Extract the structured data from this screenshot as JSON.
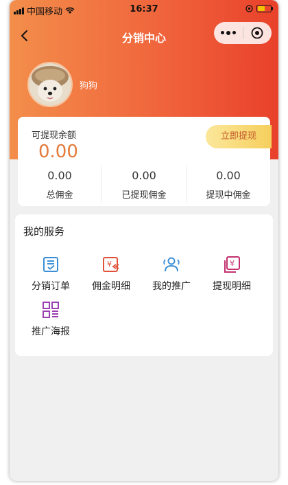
{
  "status_bar": {
    "carrier": "中国移动",
    "time": "16:37"
  },
  "nav": {
    "title": "分销中心"
  },
  "profile": {
    "username": "狗狗"
  },
  "balance": {
    "label": "可提现余额",
    "amount": "0.00",
    "withdraw_button": "立即提现"
  },
  "stats": [
    {
      "value": "0.00",
      "label": "总佣金"
    },
    {
      "value": "0.00",
      "label": "已提现佣金"
    },
    {
      "value": "0.00",
      "label": "提现中佣金"
    }
  ],
  "services": {
    "title": "我的服务",
    "items": [
      {
        "label": "分销订单",
        "icon": "order-list-icon",
        "color": "#3b8fd8"
      },
      {
        "label": "佣金明细",
        "icon": "commission-icon",
        "color": "#e0523a"
      },
      {
        "label": "我的推广",
        "icon": "users-icon",
        "color": "#3b8fd8"
      },
      {
        "label": "提现明细",
        "icon": "withdraw-record-icon",
        "color": "#c2306e"
      },
      {
        "label": "推广海报",
        "icon": "qr-poster-icon",
        "color": "#9c3fb0"
      }
    ]
  },
  "colors": {
    "header_start": "#f38e4b",
    "header_end": "#e9412b",
    "amount": "#e37a3a",
    "button_text": "#c45a2a"
  }
}
